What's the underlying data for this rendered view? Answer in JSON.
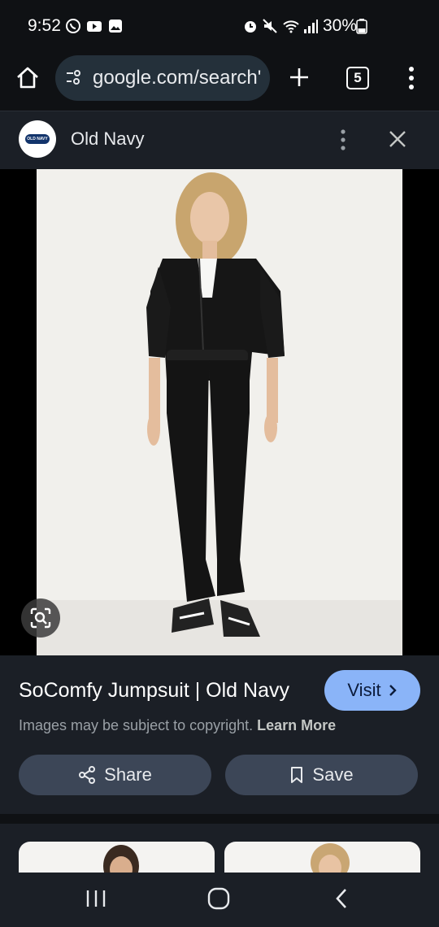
{
  "status_bar": {
    "time": "9:52",
    "battery": "30%",
    "left_icons": [
      "whatsapp-icon",
      "youtube-icon",
      "gallery-icon"
    ],
    "right_icons": [
      "alarm-icon",
      "mute-icon",
      "wifi-icon",
      "signal-icon",
      "battery-icon"
    ]
  },
  "browser": {
    "url": "google.com/search'",
    "tab_count": "5"
  },
  "source": {
    "logo_text": "OLD NAVY",
    "name": "Old Navy"
  },
  "result": {
    "title": "SoComfy Jumpsuit | Old Navy",
    "visit_label": "Visit",
    "copyright_text": "Images may be subject to copyright.",
    "learn_more": "Learn More",
    "share_label": "Share",
    "save_label": "Save"
  },
  "colors": {
    "background": "#1b1f26",
    "visit_button": "#8ab4f8",
    "action_button": "#3c4657"
  }
}
